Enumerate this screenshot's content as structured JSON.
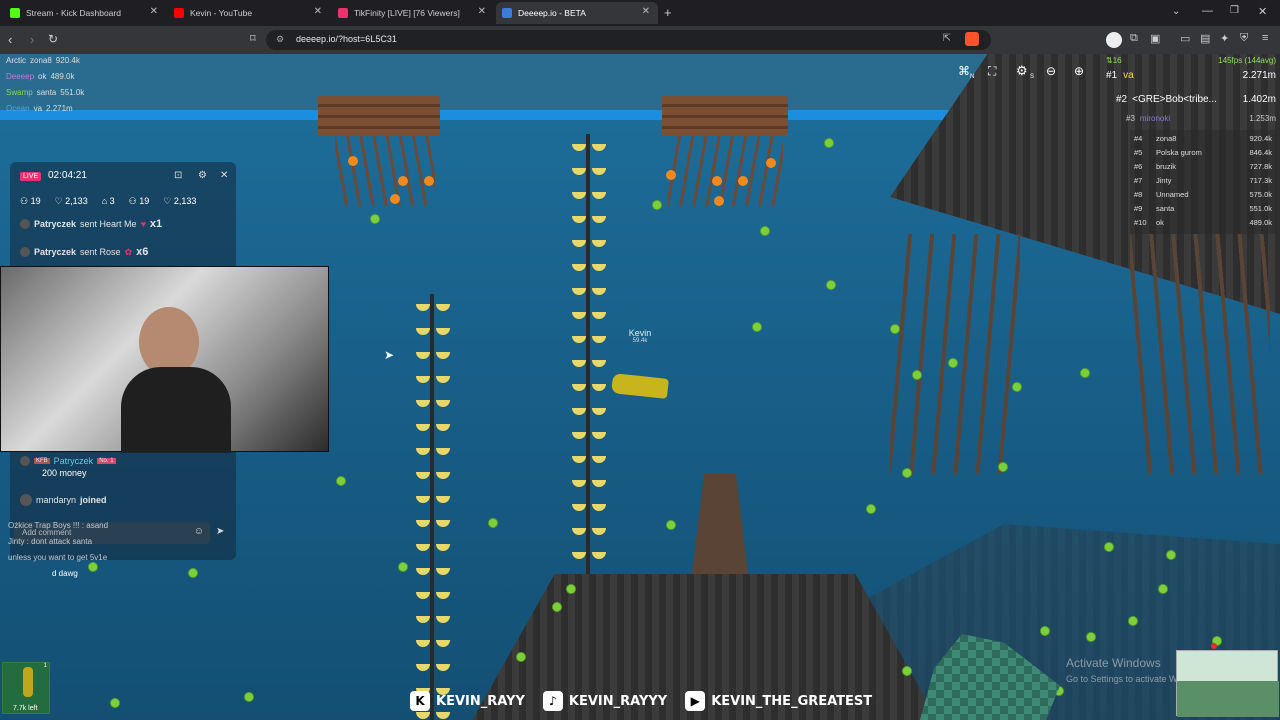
{
  "tabs": [
    {
      "label": "Stream - Kick Dashboard",
      "color": "#53fc18"
    },
    {
      "label": "Kevin - YouTube",
      "color": "#ff0000"
    },
    {
      "label": "TikFinity [LIVE] [76 Viewers]",
      "color": "#e8336d"
    },
    {
      "label": "Deeeep.io - BETA",
      "color": "#3b7bd9"
    }
  ],
  "address": {
    "url": "deeeep.io/?host=6L5C31"
  },
  "teams": [
    {
      "team": "Arctic",
      "name": "zona8",
      "score": "920.4k",
      "color": "#e0e0e0"
    },
    {
      "team": "Deeeep",
      "name": "ok",
      "score": "489.0k",
      "color": "#c27bdc"
    },
    {
      "team": "Swamp",
      "name": "santa",
      "score": "551.0k",
      "color": "#8fcf5a"
    },
    {
      "team": "Ocean",
      "name": "va",
      "score": "2.271m",
      "color": "#4aa8e8"
    }
  ],
  "live": {
    "badge": "LIVE",
    "timer": "02:04:21",
    "stats": [
      "19",
      "2,133",
      "3",
      "19",
      "2,133"
    ]
  },
  "chat": [
    {
      "user": "Patryczek",
      "msg": "sent Heart Me",
      "mult": "x1"
    },
    {
      "user": "Patryczek",
      "msg": "sent Rose",
      "mult": "x6"
    },
    {
      "tag": "KFB",
      "user": "Patryczek",
      "badge": "No. 1",
      "msg": "200 money"
    },
    {
      "user": "mandaryn",
      "msg": "joined"
    }
  ],
  "chat_input_placeholder": "Add comment",
  "overlay_chat": [
    "Ożkice Trap Boys !!! : asand",
    "Jinty : dont attack santa",
    "unless you want to get 5v1e",
    "d dawg"
  ],
  "player": {
    "name": "Kevin",
    "score": "59.4k"
  },
  "fps": "145fps (144avg)",
  "ping": "16",
  "leaderboard_top": [
    {
      "rank": "#1",
      "name": "va",
      "score": "2.271m"
    },
    {
      "rank": "#2",
      "name": "<GRE>Bob<tribe...",
      "score": "1.402m"
    },
    {
      "rank": "#3",
      "name": "mironoki",
      "score": "1.253m"
    }
  ],
  "leaderboard": [
    {
      "rank": "#4",
      "name": "zona8",
      "score": "920.4k"
    },
    {
      "rank": "#5",
      "name": "Polska gurom",
      "score": "846.4k"
    },
    {
      "rank": "#6",
      "name": "bruzik",
      "score": "727.8k"
    },
    {
      "rank": "#7",
      "name": "Jinty",
      "score": "717.3k"
    },
    {
      "rank": "#8",
      "name": "Unnamed",
      "score": "575.0k"
    },
    {
      "rank": "#9",
      "name": "santa",
      "score": "551.0k"
    },
    {
      "rank": "#10",
      "name": "ok",
      "score": "489.0k"
    }
  ],
  "ability": {
    "label": "7.7k left",
    "count": "1"
  },
  "socials": [
    {
      "logo": "K",
      "handle": "KEVIN_RAYY"
    },
    {
      "logo": "♪",
      "handle": "KEVIN_RAYYY"
    },
    {
      "logo": "▶",
      "handle": "KEVIN_THE_GREATEST"
    }
  ],
  "watermark": {
    "title": "Activate Windows",
    "sub": "Go to Settings to activate Windows."
  },
  "toolbar_keys": {
    "n": "N",
    "s": "S"
  }
}
